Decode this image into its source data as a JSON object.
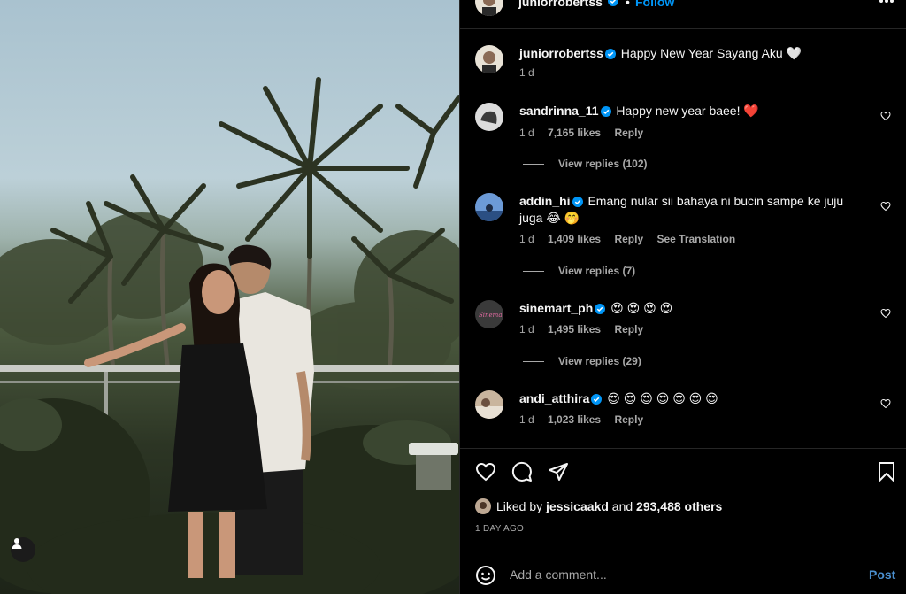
{
  "post": {
    "author": "juniorrobertss",
    "follow_label": "Follow",
    "dot": "•"
  },
  "caption": {
    "username": "juniorrobertss",
    "text": "Happy New Year Sayang Aku 🤍",
    "time": "1 d"
  },
  "comments": [
    {
      "username": "sandrinna_11",
      "text": "Happy new year baee! ❤️",
      "time": "1 d",
      "likes": "7,165 likes",
      "reply": "Reply",
      "translate": "",
      "replies": "View replies (102)"
    },
    {
      "username": "addin_hi",
      "text": "Emang nular sii bahaya ni bucin sampe ke juju juga 😂 🤭",
      "time": "1 d",
      "likes": "1,409 likes",
      "reply": "Reply",
      "translate": "See Translation",
      "replies": "View replies (7)"
    },
    {
      "username": "sinemart_ph",
      "text": "😍 😍 😍 😍",
      "time": "1 d",
      "likes": "1,495 likes",
      "reply": "Reply",
      "translate": "",
      "replies": "View replies (29)"
    },
    {
      "username": "andi_atthira",
      "text": "😍 😍 😍 😍 😍 😍 😍",
      "time": "1 d",
      "likes": "1,023 likes",
      "reply": "Reply",
      "translate": "",
      "replies": ""
    }
  ],
  "likes": {
    "prefix": "Liked by",
    "user": "jessicaakd",
    "and": "and",
    "others": "293,488 others"
  },
  "age": "1 DAY AGO",
  "composer": {
    "placeholder": "Add a comment...",
    "post_label": "Post"
  },
  "colors": {
    "accent": "#0095f6",
    "background": "#000000",
    "muted": "#a8a8a8",
    "like_red": "#ff3040"
  },
  "icons": [
    "heart-icon",
    "comment-icon",
    "share-icon",
    "bookmark-icon",
    "verified-badge-icon",
    "more-icon",
    "emoji-icon",
    "user-tag-icon"
  ]
}
